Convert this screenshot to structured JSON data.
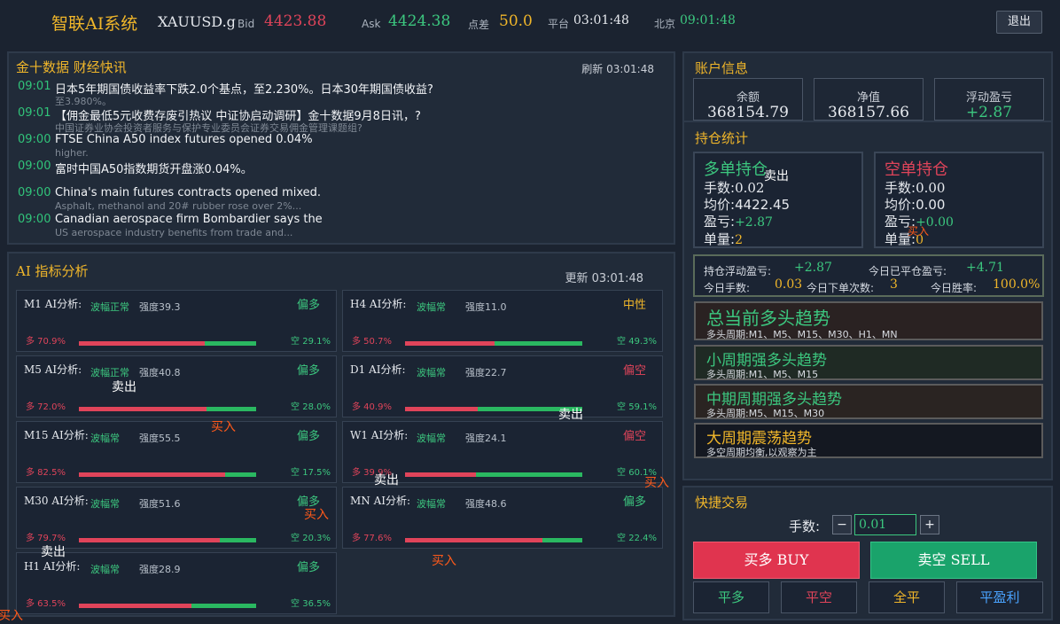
{
  "header": {
    "app_title": "智联AI系统",
    "symbol": "XAUUSD.g",
    "bid_label": "Bid",
    "bid_value": "4423.88",
    "ask_label": "Ask",
    "ask_value": "4424.38",
    "spread_label": "点差",
    "spread_value": "50.0",
    "platform_label": "平台",
    "platform_time": "03:01:48",
    "beijing_label": "北京",
    "beijing_time": "09:01:48",
    "logout_label": "退出"
  },
  "news": {
    "title": "金十数据 财经快讯",
    "refresh_label": "刷新 03:01:48",
    "items": [
      {
        "time": "09:01",
        "title": "日本5年期国债收益率下跌2.0个基点，至2.230%。日本30年期国债收益?",
        "sub": "至3.980%。"
      },
      {
        "time": "09:01",
        "title": "【佣金最低5元收费存废引热议 中证协启动调研】金十数据9月8日讯，?",
        "sub": "中国证券业协会投资者服务与保护专业委员会证券交易佣金管理课题组?"
      },
      {
        "time": "09:00",
        "title": "FTSE China A50 index futures opened 0.04%",
        "sub": "higher."
      },
      {
        "time": "09:00",
        "title": "富时中国A50指数期货开盘涨0.04%。",
        "sub": ""
      },
      {
        "time": "09:00",
        "title": "China's main futures contracts opened mixed.",
        "sub": "Asphalt, methanol and 20# rubber rose over 2%..."
      },
      {
        "time": "09:00",
        "title": "Canadian aerospace firm Bombardier says the",
        "sub": "US aerospace industry benefits from trade and..."
      }
    ]
  },
  "ai": {
    "title": "AI 指标分析",
    "update_label": "更新 03:01:48",
    "cards": [
      {
        "name": "M1 AI分析:",
        "wave": "波幅正常",
        "strength": "强度39.3",
        "bias": "偏多",
        "bias_color": "#3cc77f",
        "long": "多 70.9%",
        "short": "空 29.1%",
        "long_frac": 0.709
      },
      {
        "name": "H4 AI分析:",
        "wave": "波幅常",
        "strength": "强度11.0",
        "bias": "中性",
        "bias_color": "#f0b62a",
        "long": "多 50.7%",
        "short": "空 49.3%",
        "long_frac": 0.507
      },
      {
        "name": "M5 AI分析:",
        "wave": "波幅正常",
        "strength": "强度40.8",
        "bias": "偏多",
        "bias_color": "#3cc77f",
        "long": "多 72.0%",
        "short": "空 28.0%",
        "long_frac": 0.72
      },
      {
        "name": "D1 AI分析:",
        "wave": "波幅常",
        "strength": "强度22.7",
        "bias": "偏空",
        "bias_color": "#e0445a",
        "long": "多 40.9%",
        "short": "空 59.1%",
        "long_frac": 0.409
      },
      {
        "name": "M15 AI分析:",
        "wave": "波幅常",
        "strength": "强度55.5",
        "bias": "偏多",
        "bias_color": "#3cc77f",
        "long": "多 82.5%",
        "short": "空 17.5%",
        "long_frac": 0.825
      },
      {
        "name": "W1 AI分析:",
        "wave": "波幅常",
        "strength": "强度24.1",
        "bias": "偏空",
        "bias_color": "#e0445a",
        "long": "多 39.9%",
        "short": "空 60.1%",
        "long_frac": 0.399
      },
      {
        "name": "M30 AI分析:",
        "wave": "波幅常",
        "strength": "强度51.6",
        "bias": "偏多",
        "bias_color": "#3cc77f",
        "long": "多 79.7%",
        "short": "空 20.3%",
        "long_frac": 0.797
      },
      {
        "name": "MN AI分析:",
        "wave": "波幅常",
        "strength": "强度48.6",
        "bias": "偏多",
        "bias_color": "#3cc77f",
        "long": "多 77.6%",
        "short": "空 22.4%",
        "long_frac": 0.776
      },
      {
        "name": "H1 AI分析:",
        "wave": "波幅常",
        "strength": "强度28.9",
        "bias": "偏多",
        "bias_color": "#3cc77f",
        "long": "多 63.5%",
        "short": "空 36.5%",
        "long_frac": 0.635
      }
    ]
  },
  "markers": {
    "sell": "卖出",
    "buy": "买入"
  },
  "account": {
    "title": "账户信息",
    "balance_label": "余额",
    "balance_value": "368154.79",
    "equity_label": "净值",
    "equity_value": "368157.66",
    "float_label": "浮动盈亏",
    "float_value": "+2.87"
  },
  "positions": {
    "title": "持仓统计",
    "long": {
      "title": "多单持仓",
      "lots_label": "手数:",
      "lots": "0.02",
      "avg_label": "均价:",
      "avg": "4422.45",
      "pnl_label": "盈亏:",
      "pnl": "+2.87",
      "count_label": "单量:",
      "count": "2"
    },
    "short": {
      "title": "空单持仓",
      "lots_label": "手数:",
      "lots": "0.00",
      "avg_label": "均价:",
      "avg": "0.00",
      "pnl_label": "盈亏:",
      "pnl": "+0.00",
      "count_label": "单量:",
      "count": "0"
    },
    "summary": {
      "float_label": "持仓浮动盈亏:",
      "float_value": "+2.87",
      "closed_label": "今日已平仓盈亏:",
      "closed_value": "+4.71",
      "lots_label": "今日手数:",
      "lots_value": "0.03",
      "orders_label": "今日下单次数:",
      "orders_value": "3",
      "winrate_label": "今日胜率:",
      "winrate_value": "100.0%"
    },
    "trends": [
      {
        "title": "总当前多头趋势",
        "sub": "多头周期:M1、M5、M15、M30、H1、MN",
        "color": "#3cc77f",
        "bg": "#2a2222"
      },
      {
        "title": "小周期强多头趋势",
        "sub": "多头周期:M1、M5、M15",
        "color": "#3cc77f",
        "bg": "#1f2a24"
      },
      {
        "title": "中期周期强多头趋势",
        "sub": "多头周期:M5、M15、M30",
        "color": "#3cc77f",
        "bg": "#2a2422"
      },
      {
        "title": "大周期震荡趋势",
        "sub": "多空周期均衡,以观察为主",
        "color": "#f0b62a",
        "bg": "#141821"
      }
    ]
  },
  "trade": {
    "title": "快捷交易",
    "lots_label": "手数:",
    "lots_value": "0.01",
    "minus": "−",
    "plus": "+",
    "buy_label": "买多 BUY",
    "sell_label": "卖空 SELL",
    "close_long": "平多",
    "close_short": "平空",
    "close_all": "全平",
    "close_profit": "平盈利"
  },
  "colors": {
    "accent": "#f0b62a",
    "bull": "#3cc77f",
    "bear": "#e0445a",
    "buy_button": "#e0344f",
    "sell_button": "#1aa36b"
  }
}
